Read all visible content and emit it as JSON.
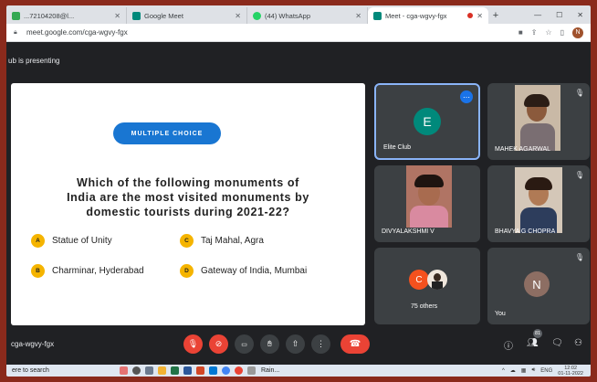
{
  "browser": {
    "tabs": [
      {
        "label": "...72104208@l...",
        "active": false,
        "favicon_color": "#34a853"
      },
      {
        "label": "Google Meet",
        "active": false,
        "favicon_color": "#00897b"
      },
      {
        "label": "(44) WhatsApp",
        "active": false,
        "favicon_color": "#25d366"
      },
      {
        "label": "Meet - cga-wgvy-fgx",
        "active": true,
        "favicon_color": "#00897b"
      }
    ],
    "new_tab": "+",
    "url": "meet.google.com/cga-wgvy-fgx",
    "profile_initial": "N"
  },
  "meet": {
    "presenting_label": "ub is presenting",
    "slide": {
      "pill": "MULTIPLE CHOICE",
      "question_lines": [
        "Which of the following monuments of",
        "India are the most visited monuments by",
        "domestic tourists during 2021-22?"
      ],
      "options": [
        {
          "letter": "A",
          "text": "Statue of Unity"
        },
        {
          "letter": "C",
          "text": "Taj Mahal, Agra"
        },
        {
          "letter": "B",
          "text": "Charminar, Hyderabad"
        },
        {
          "letter": "D",
          "text": "Gateway of India, Mumbai"
        }
      ]
    },
    "participants": [
      {
        "name": "Elite Club",
        "initial": "E",
        "avatar_color": "#00897b"
      },
      {
        "name": "MAHEK AGARWAL"
      },
      {
        "name": "DIVYALAKSHMI V"
      },
      {
        "name": "BHAVYA G CHOPRA"
      },
      {
        "name": "75 others",
        "initial": "C",
        "avatar_color": "#f4511e"
      },
      {
        "name": "You",
        "initial": "N",
        "avatar_color": "#8d6e63"
      }
    ],
    "meeting_code": "cga-wgvy-fgx",
    "participant_count": "81"
  },
  "taskbar": {
    "search_placeholder": "ere to search",
    "weather": "Rain...",
    "lang": "ENG",
    "time": "12:02",
    "date": "01-11-2022"
  },
  "colors": {
    "meet_bg": "#202124",
    "tile_bg": "#3c4043",
    "accent": "#1a73e8",
    "danger": "#ea4335",
    "option_badge": "#f5b400"
  }
}
